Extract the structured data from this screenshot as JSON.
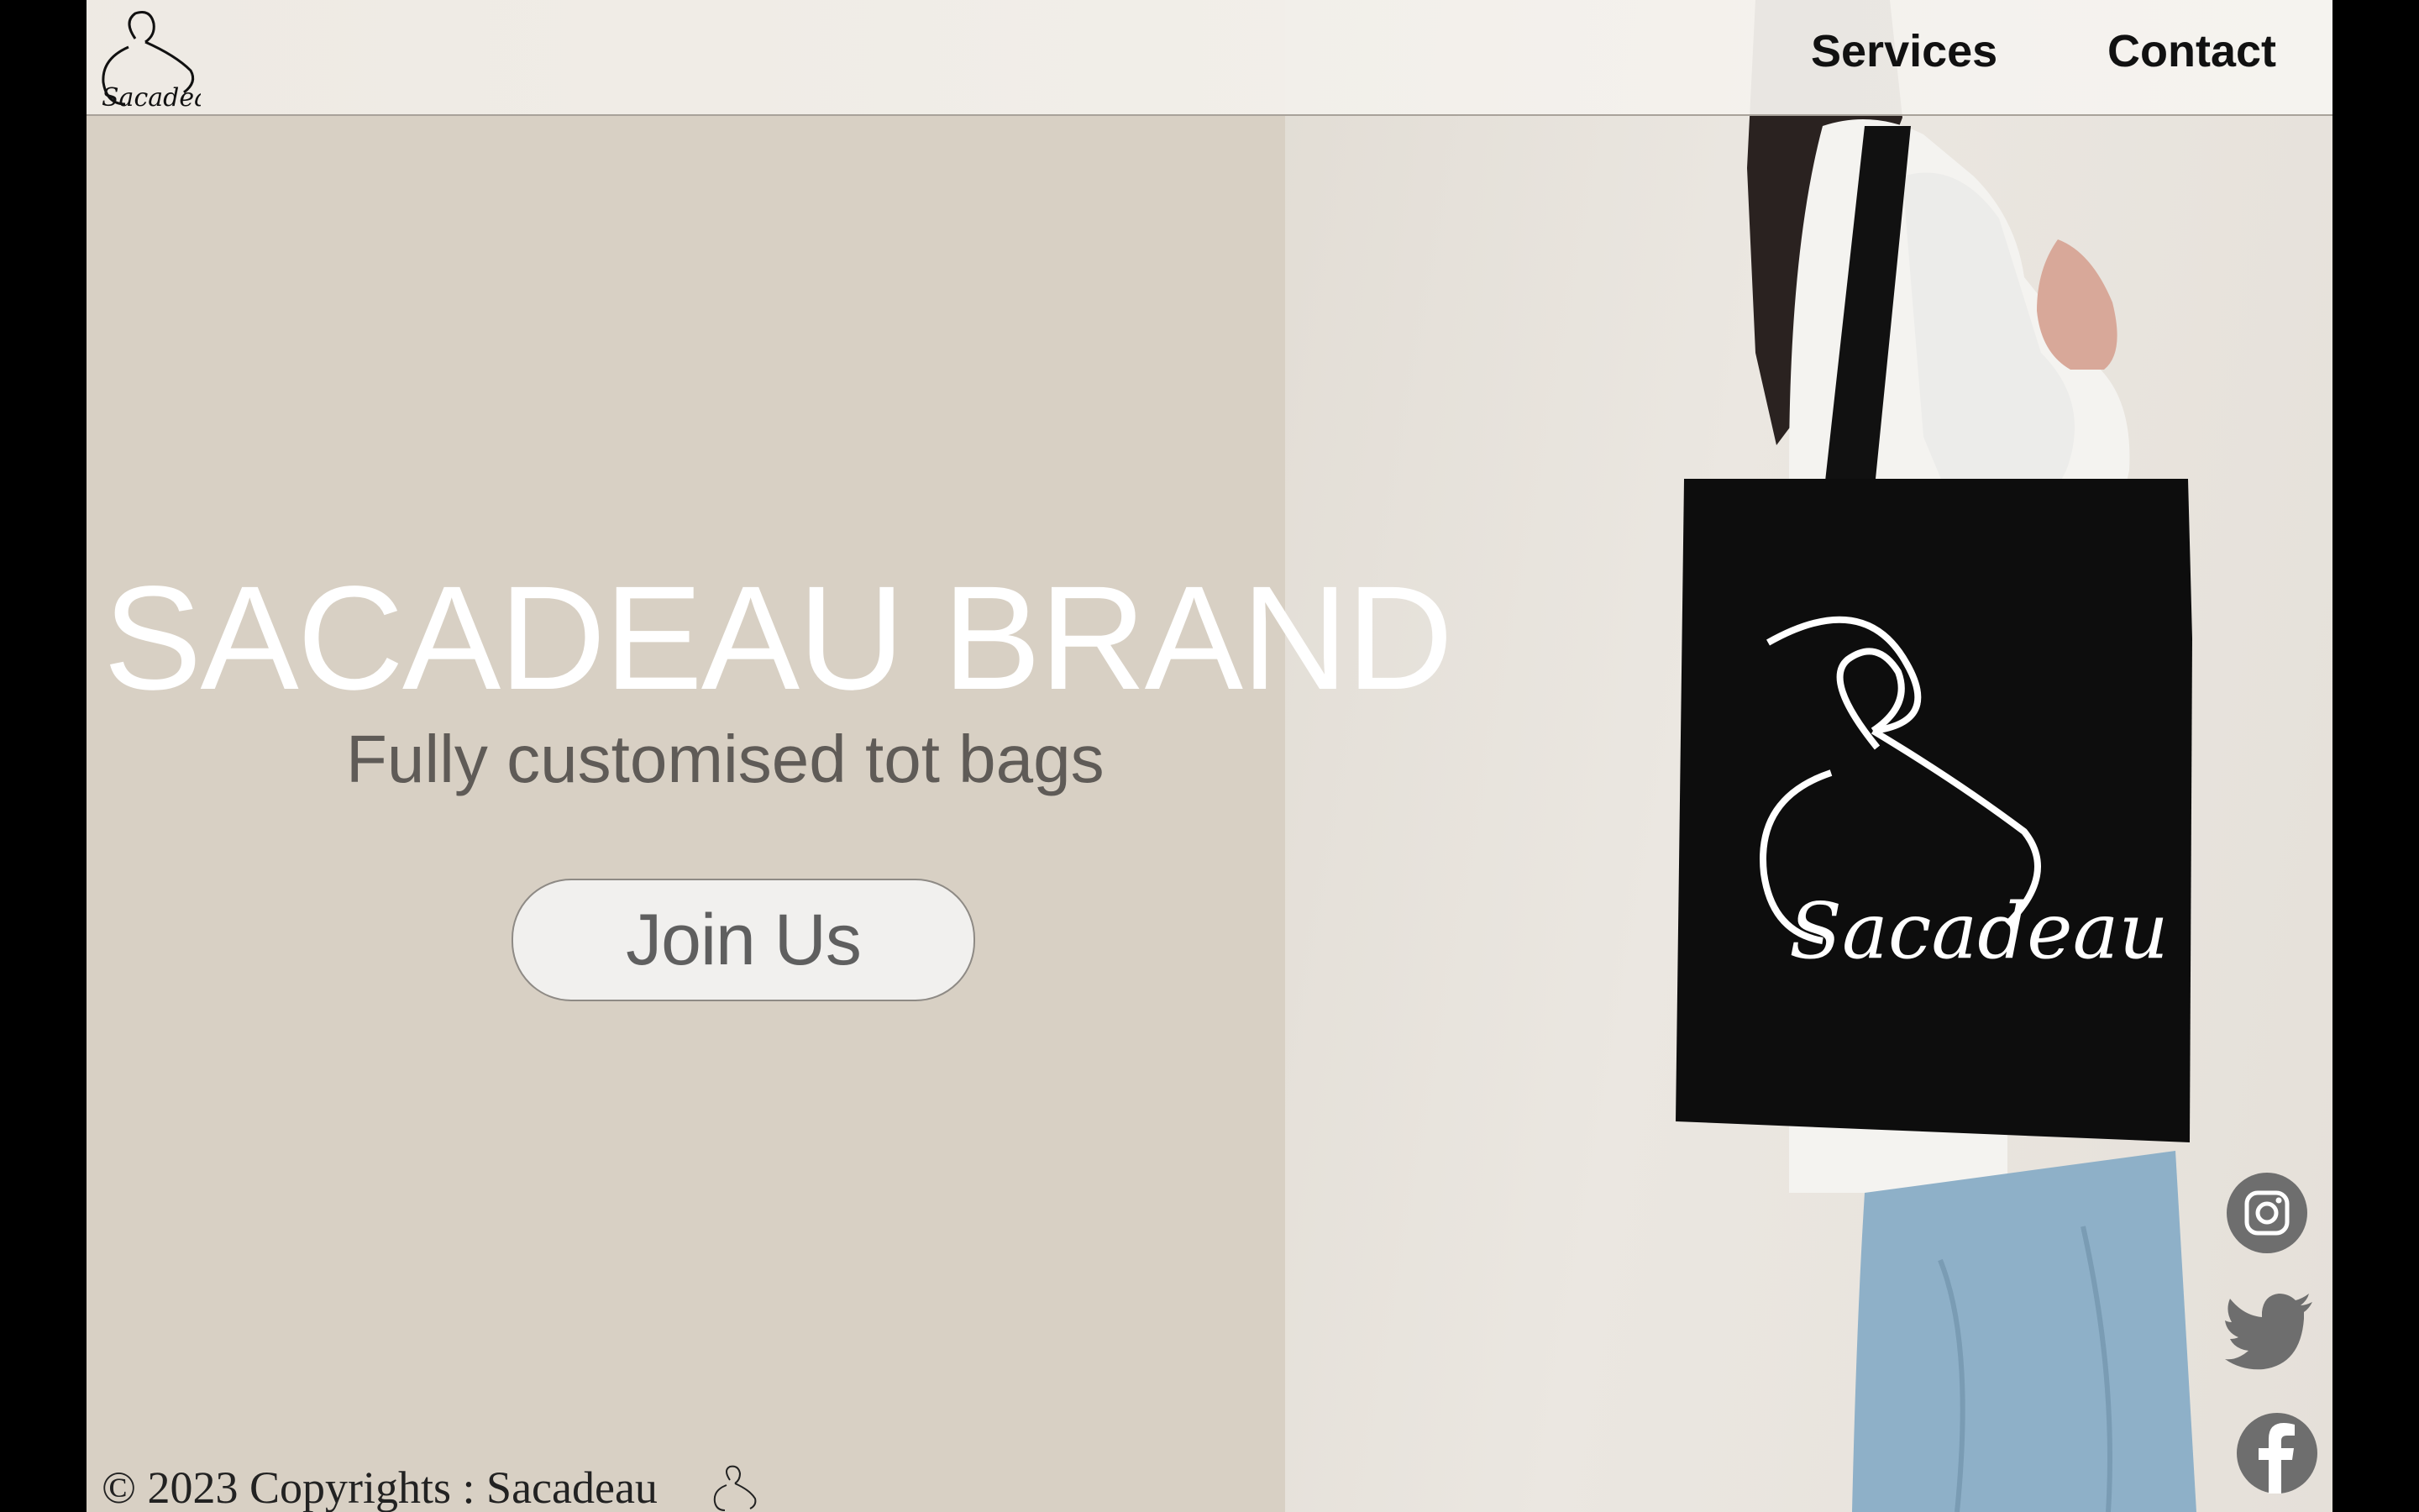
{
  "brand": {
    "logo_text": "Sacadeau"
  },
  "nav": {
    "items": [
      {
        "label": "Services"
      },
      {
        "label": "Contact"
      }
    ]
  },
  "hero": {
    "title": "SACADEAU BRAND",
    "subtitle": "Fully customised tot bags",
    "cta_label": "Join Us",
    "bag_logo_text": "Sacadeau"
  },
  "footer": {
    "copyright": "© 2023 Copyrights : Sacadeau"
  },
  "social": [
    {
      "name": "instagram-icon"
    },
    {
      "name": "twitter-icon"
    },
    {
      "name": "facebook-icon"
    }
  ],
  "colors": {
    "beige": "#d8d0c4",
    "photo_bg": "#e6e1da",
    "title": "#ffffff",
    "subtitle": "#5f5b57",
    "button_bg": "#f1f0ee",
    "icon_gray": "#6e6e6e"
  }
}
